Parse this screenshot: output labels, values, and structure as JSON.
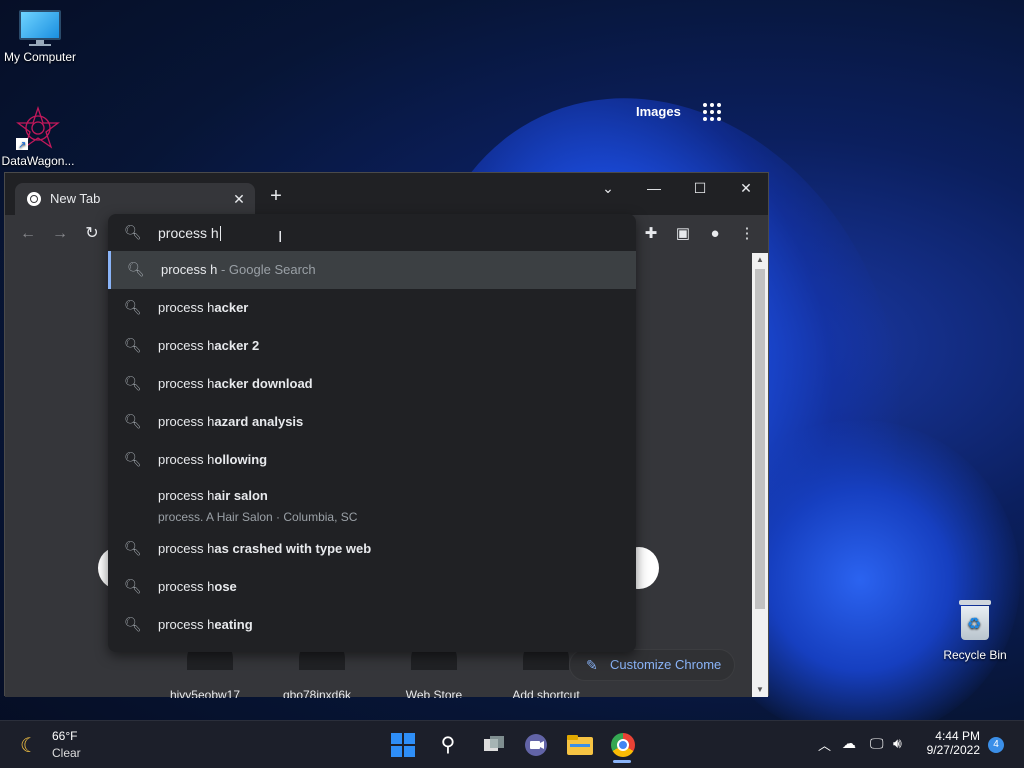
{
  "desktop": {
    "icons": [
      {
        "label": "My Computer"
      },
      {
        "label": "DataWagon..."
      },
      {
        "label": "Recycle Bin"
      }
    ]
  },
  "browser": {
    "tab_title": "New Tab",
    "tab_close": "✕",
    "new_tab": "+",
    "window_controls": {
      "list": "⌄",
      "minimize": "—",
      "maximize": "☐",
      "close": "✕"
    },
    "omnibox": {
      "query": "process h",
      "suggestions": [
        {
          "prefix": "process h",
          "rest": "",
          "suffix": " - Google Search",
          "selected": true
        },
        {
          "prefix": "process h",
          "rest": "acker"
        },
        {
          "prefix": "process h",
          "rest": "acker 2"
        },
        {
          "prefix": "process h",
          "rest": "acker download"
        },
        {
          "prefix": "process h",
          "rest": "azard analysis"
        },
        {
          "prefix": "process h",
          "rest": "ollowing"
        },
        {
          "prefix": "process h",
          "rest": "air salon",
          "sub": "process. A Hair Salon · Columbia, SC"
        },
        {
          "prefix": "process h",
          "rest": "as crashed with type web"
        },
        {
          "prefix": "process h",
          "rest": "ose"
        },
        {
          "prefix": "process h",
          "rest": "eating"
        }
      ]
    },
    "ntp": {
      "images_label": "Images",
      "shortcuts": [
        "hiyy5eobw17",
        "qbo78inxd6k",
        "Web Store",
        "Add shortcut"
      ],
      "customize_label": "Customize Chrome"
    }
  },
  "taskbar": {
    "weather_temp": "66°F",
    "weather_desc": "Clear",
    "time": "4:44 PM",
    "date": "9/27/2022",
    "notifications": "4"
  }
}
